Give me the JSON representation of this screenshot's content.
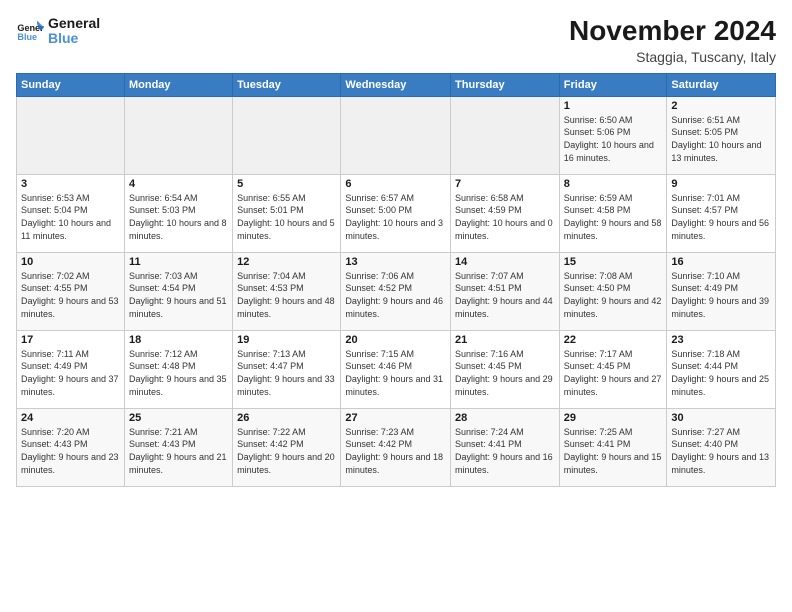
{
  "logo": {
    "line1": "General",
    "line2": "Blue"
  },
  "header": {
    "title": "November 2024",
    "location": "Staggia, Tuscany, Italy"
  },
  "calendar": {
    "headers": [
      "Sunday",
      "Monday",
      "Tuesday",
      "Wednesday",
      "Thursday",
      "Friday",
      "Saturday"
    ],
    "weeks": [
      [
        {
          "day": "",
          "info": ""
        },
        {
          "day": "",
          "info": ""
        },
        {
          "day": "",
          "info": ""
        },
        {
          "day": "",
          "info": ""
        },
        {
          "day": "",
          "info": ""
        },
        {
          "day": "1",
          "info": "Sunrise: 6:50 AM\nSunset: 5:06 PM\nDaylight: 10 hours and 16 minutes."
        },
        {
          "day": "2",
          "info": "Sunrise: 6:51 AM\nSunset: 5:05 PM\nDaylight: 10 hours and 13 minutes."
        }
      ],
      [
        {
          "day": "3",
          "info": "Sunrise: 6:53 AM\nSunset: 5:04 PM\nDaylight: 10 hours and 11 minutes."
        },
        {
          "day": "4",
          "info": "Sunrise: 6:54 AM\nSunset: 5:03 PM\nDaylight: 10 hours and 8 minutes."
        },
        {
          "day": "5",
          "info": "Sunrise: 6:55 AM\nSunset: 5:01 PM\nDaylight: 10 hours and 5 minutes."
        },
        {
          "day": "6",
          "info": "Sunrise: 6:57 AM\nSunset: 5:00 PM\nDaylight: 10 hours and 3 minutes."
        },
        {
          "day": "7",
          "info": "Sunrise: 6:58 AM\nSunset: 4:59 PM\nDaylight: 10 hours and 0 minutes."
        },
        {
          "day": "8",
          "info": "Sunrise: 6:59 AM\nSunset: 4:58 PM\nDaylight: 9 hours and 58 minutes."
        },
        {
          "day": "9",
          "info": "Sunrise: 7:01 AM\nSunset: 4:57 PM\nDaylight: 9 hours and 56 minutes."
        }
      ],
      [
        {
          "day": "10",
          "info": "Sunrise: 7:02 AM\nSunset: 4:55 PM\nDaylight: 9 hours and 53 minutes."
        },
        {
          "day": "11",
          "info": "Sunrise: 7:03 AM\nSunset: 4:54 PM\nDaylight: 9 hours and 51 minutes."
        },
        {
          "day": "12",
          "info": "Sunrise: 7:04 AM\nSunset: 4:53 PM\nDaylight: 9 hours and 48 minutes."
        },
        {
          "day": "13",
          "info": "Sunrise: 7:06 AM\nSunset: 4:52 PM\nDaylight: 9 hours and 46 minutes."
        },
        {
          "day": "14",
          "info": "Sunrise: 7:07 AM\nSunset: 4:51 PM\nDaylight: 9 hours and 44 minutes."
        },
        {
          "day": "15",
          "info": "Sunrise: 7:08 AM\nSunset: 4:50 PM\nDaylight: 9 hours and 42 minutes."
        },
        {
          "day": "16",
          "info": "Sunrise: 7:10 AM\nSunset: 4:49 PM\nDaylight: 9 hours and 39 minutes."
        }
      ],
      [
        {
          "day": "17",
          "info": "Sunrise: 7:11 AM\nSunset: 4:49 PM\nDaylight: 9 hours and 37 minutes."
        },
        {
          "day": "18",
          "info": "Sunrise: 7:12 AM\nSunset: 4:48 PM\nDaylight: 9 hours and 35 minutes."
        },
        {
          "day": "19",
          "info": "Sunrise: 7:13 AM\nSunset: 4:47 PM\nDaylight: 9 hours and 33 minutes."
        },
        {
          "day": "20",
          "info": "Sunrise: 7:15 AM\nSunset: 4:46 PM\nDaylight: 9 hours and 31 minutes."
        },
        {
          "day": "21",
          "info": "Sunrise: 7:16 AM\nSunset: 4:45 PM\nDaylight: 9 hours and 29 minutes."
        },
        {
          "day": "22",
          "info": "Sunrise: 7:17 AM\nSunset: 4:45 PM\nDaylight: 9 hours and 27 minutes."
        },
        {
          "day": "23",
          "info": "Sunrise: 7:18 AM\nSunset: 4:44 PM\nDaylight: 9 hours and 25 minutes."
        }
      ],
      [
        {
          "day": "24",
          "info": "Sunrise: 7:20 AM\nSunset: 4:43 PM\nDaylight: 9 hours and 23 minutes."
        },
        {
          "day": "25",
          "info": "Sunrise: 7:21 AM\nSunset: 4:43 PM\nDaylight: 9 hours and 21 minutes."
        },
        {
          "day": "26",
          "info": "Sunrise: 7:22 AM\nSunset: 4:42 PM\nDaylight: 9 hours and 20 minutes."
        },
        {
          "day": "27",
          "info": "Sunrise: 7:23 AM\nSunset: 4:42 PM\nDaylight: 9 hours and 18 minutes."
        },
        {
          "day": "28",
          "info": "Sunrise: 7:24 AM\nSunset: 4:41 PM\nDaylight: 9 hours and 16 minutes."
        },
        {
          "day": "29",
          "info": "Sunrise: 7:25 AM\nSunset: 4:41 PM\nDaylight: 9 hours and 15 minutes."
        },
        {
          "day": "30",
          "info": "Sunrise: 7:27 AM\nSunset: 4:40 PM\nDaylight: 9 hours and 13 minutes."
        }
      ]
    ]
  }
}
